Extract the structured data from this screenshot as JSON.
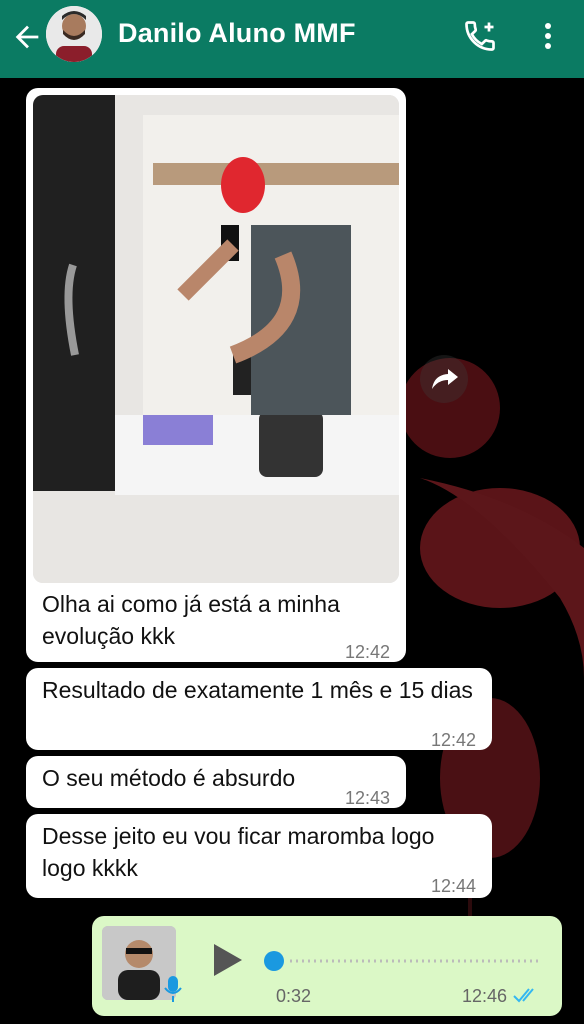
{
  "header": {
    "title": "Danilo Aluno MMF",
    "background": "#0b7b63",
    "icons": [
      "back-arrow-icon",
      "avatar",
      "add-call-icon",
      "more-vert-icon"
    ]
  },
  "messages": [
    {
      "type": "image",
      "caption": "Olha ai como já está a minha evolução kkk",
      "time": "12:42"
    },
    {
      "type": "text",
      "text": "Resultado de exatamente 1 mês e 15 dias",
      "time": "12:42"
    },
    {
      "type": "text",
      "text": "O seu método é absurdo",
      "time": "12:43"
    },
    {
      "type": "text",
      "text": "Desse jeito eu vou ficar maromba logo logo kkkk",
      "time": "12:44"
    }
  ],
  "voice": {
    "duration": "0:32",
    "time": "12:46",
    "status": "read",
    "bubble_color": "#dbf8c6",
    "progress": 0
  }
}
